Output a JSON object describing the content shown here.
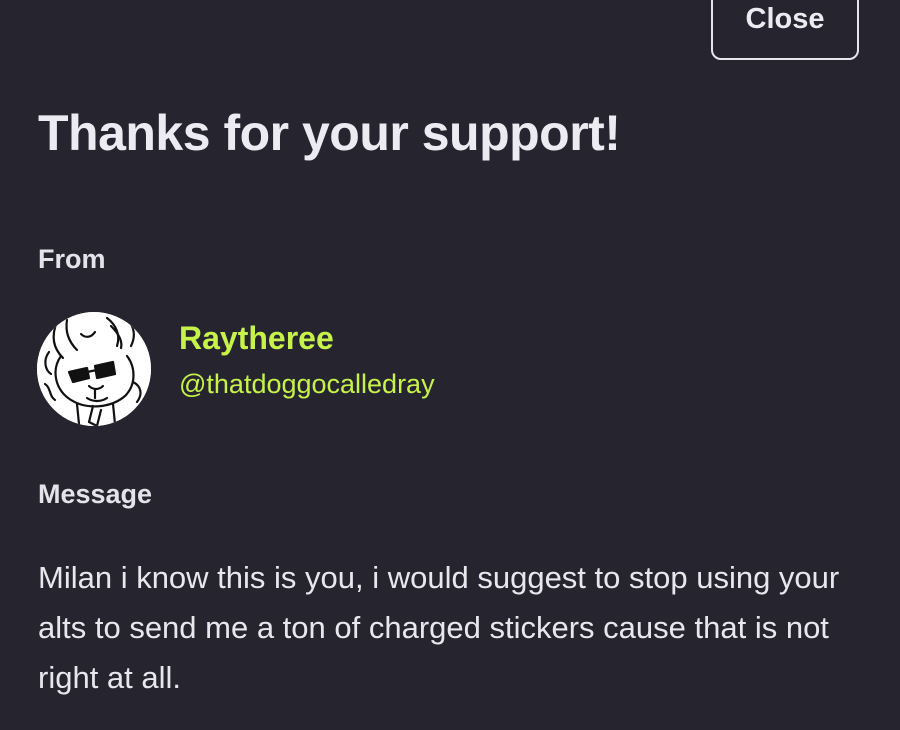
{
  "modal": {
    "close_label": "Close",
    "title": "Thanks for your support!",
    "from_label": "From",
    "sender": {
      "name": "Raytheree",
      "handle": "@thatdoggocalledray",
      "avatar_icon": "dog-sketch-avatar-icon",
      "accent_color": "#c6f24a"
    },
    "message_label": "Message",
    "message_text": "Milan i know this is you, i would suggest to stop using your alts to send me a ton of charged stickers cause that is not right at all."
  },
  "colors": {
    "background": "#26252f",
    "text": "#ecebf2",
    "accent": "#c6f24a"
  }
}
